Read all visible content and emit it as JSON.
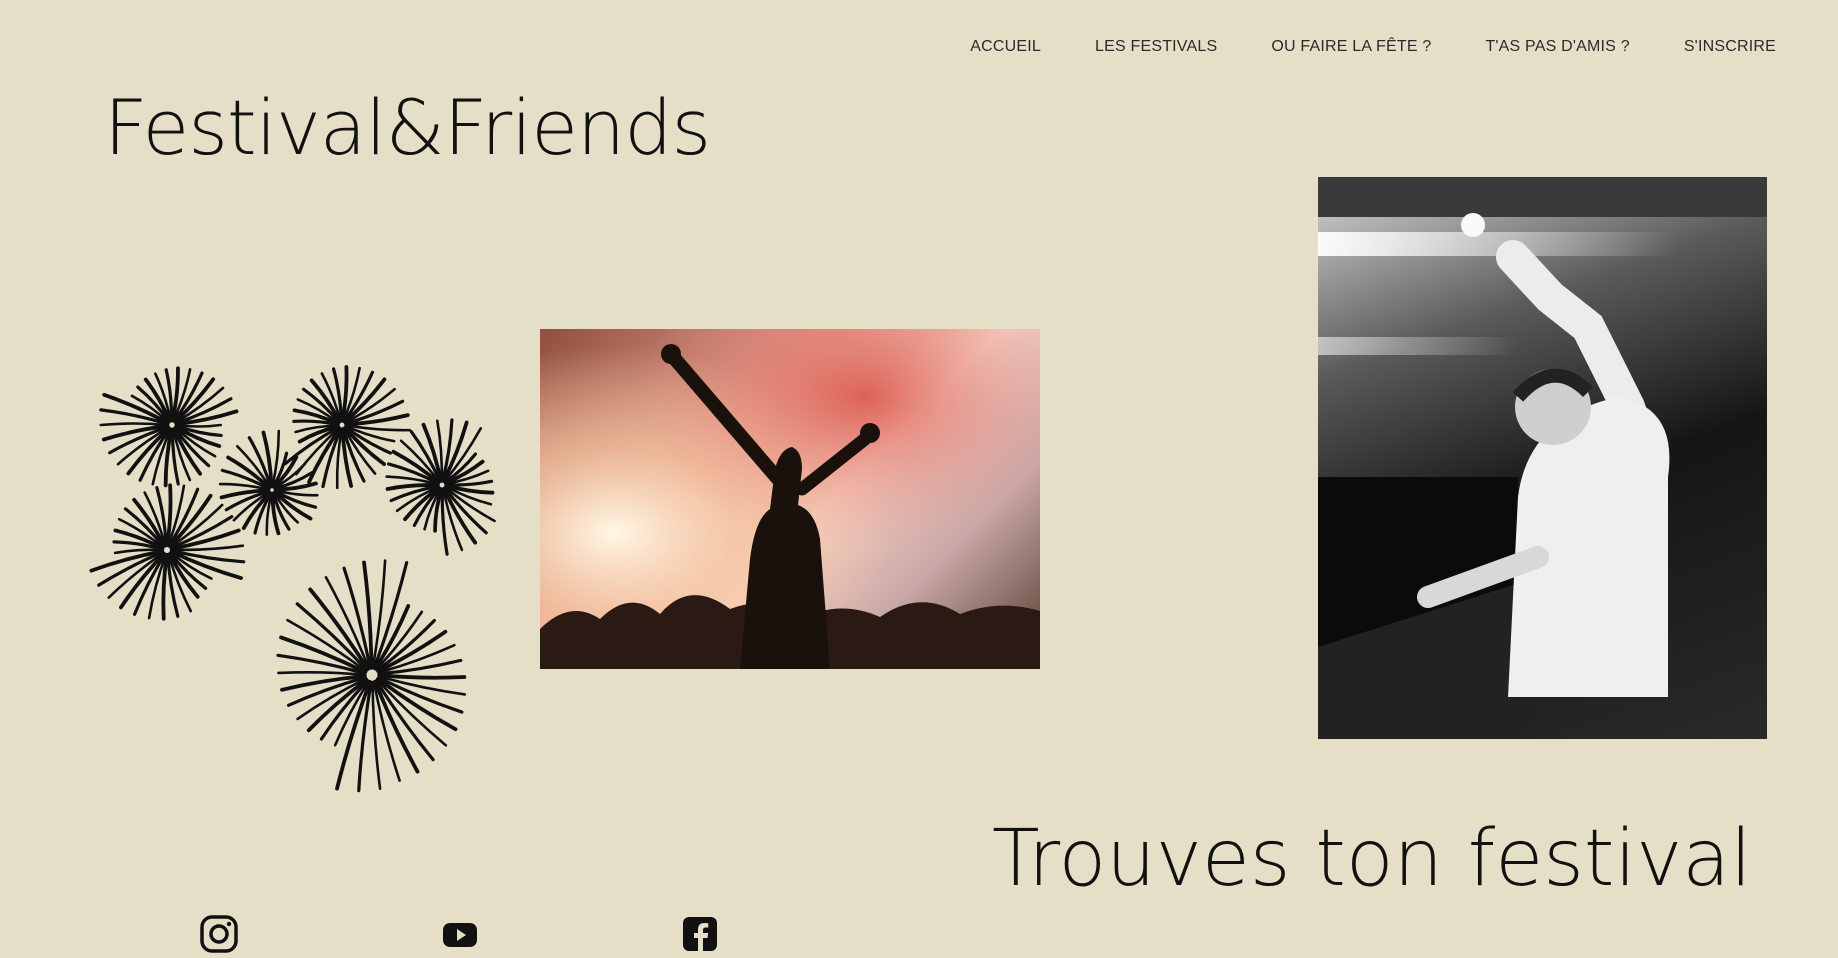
{
  "nav": {
    "items": [
      {
        "label": "ACCUEIL"
      },
      {
        "label": "LES FESTIVALS"
      },
      {
        "label": "OU FAIRE LA FÊTE ?"
      },
      {
        "label": "T'AS PAS D'AMIS ?"
      },
      {
        "label": "S'INSCRIRE"
      }
    ]
  },
  "brand": {
    "title": "Festival&Friends"
  },
  "hero": {
    "title": "Trouves ton festival"
  },
  "images": {
    "party": "party-crowd-photo",
    "dj": "dj-performing-photo",
    "decor": "fireworks-illustration"
  },
  "social": {
    "instagram": "instagram-icon",
    "youtube": "youtube-icon",
    "facebook": "facebook-icon"
  },
  "colors": {
    "background": "#e6dfc8",
    "text": "#111111",
    "nav_text": "#2a2a2a"
  }
}
